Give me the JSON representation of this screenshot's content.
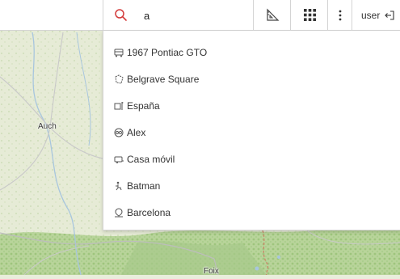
{
  "search": {
    "value": "a",
    "placeholder": ""
  },
  "toolbar": {
    "user_label": "user"
  },
  "icons": {
    "search": "search-icon",
    "measure": "ruler-triangle-icon",
    "apps": "grid-icon",
    "menu": "vertical-dots-icon",
    "logout": "logout-icon"
  },
  "results": [
    {
      "label": "1967 Pontiac GTO",
      "icon": "car-icon"
    },
    {
      "label": "Belgrave Square",
      "icon": "polygon-icon"
    },
    {
      "label": "España",
      "icon": "flag-icon"
    },
    {
      "label": "Alex",
      "icon": "glasses-icon"
    },
    {
      "label": "Casa móvil",
      "icon": "caravan-icon"
    },
    {
      "label": "Batman",
      "icon": "figure-icon"
    },
    {
      "label": "Barcelona",
      "icon": "pin-icon"
    }
  ],
  "map": {
    "places": [
      "Auch",
      "Foix"
    ]
  },
  "colors": {
    "accent": "#d33a3a",
    "border": "#d4d4d4",
    "map_base": "#e9eddc"
  }
}
